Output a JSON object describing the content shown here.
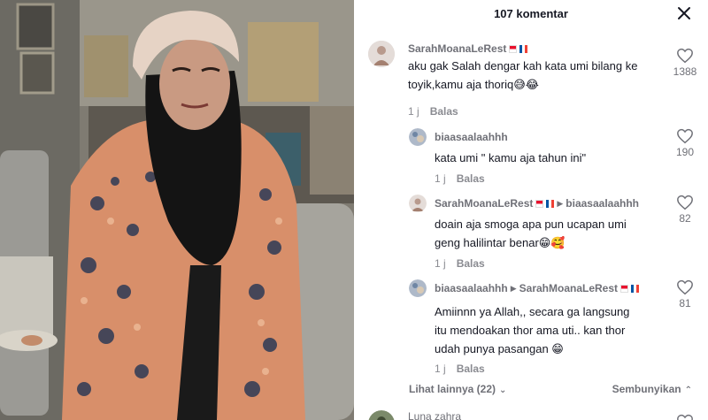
{
  "video": {
    "description_icon": "video-frame"
  },
  "header": {
    "title": "107 komentar",
    "close_icon": "close-icon"
  },
  "comments": [
    {
      "username": "SarahMoanaLeRest",
      "text": "aku gak Salah dengar kah kata umi bilang ke toyik,kamu aja thoriq😅😂",
      "time": "1 j",
      "reply_label": "Balas",
      "likes": "1388"
    },
    {
      "username": "biaasaalaahhh",
      "text": "kata umi \" kamu aja tahun ini\"",
      "time": "1 j",
      "reply_label": "Balas",
      "likes": "190"
    },
    {
      "username": "SarahMoanaLeRest",
      "reply_to": "biaasaalaahhh",
      "text": "doain aja smoga apa pun ucapan umi geng halilintar benar😁🥰",
      "time": "1 j",
      "reply_label": "Balas",
      "likes": "82"
    },
    {
      "username": "biaasaalaahhh",
      "reply_to": "SarahMoanaLeRest",
      "text": "Amiinnn ya Allah,, secara ga langsung itu mendoakan thor ama uti.. kan thor udah punya pasangan 😁",
      "time": "1 j",
      "reply_label": "Balas",
      "likes": "81"
    },
    {
      "username": "Luna zahra"
    }
  ],
  "more": {
    "view_more": "Lihat lainnya (22)",
    "hide": "Sembunyikan"
  }
}
